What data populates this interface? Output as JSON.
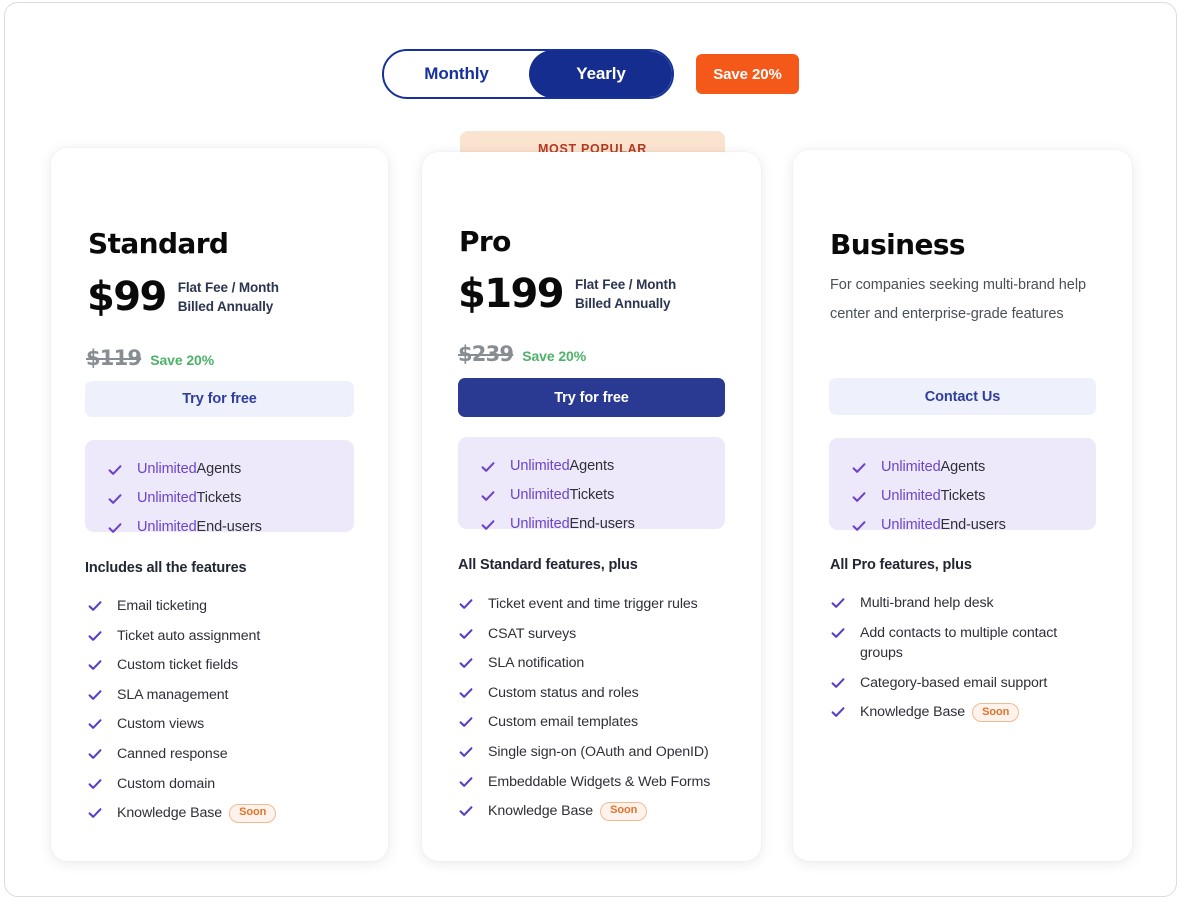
{
  "billing_toggle": {
    "monthly_label": "Monthly",
    "yearly_label": "Yearly",
    "selected": "Yearly",
    "save_badge_label": "Save 20%",
    "accent_color": "#17329b",
    "save_badge_color": "#f4591a"
  },
  "most_popular_label": "MOST POPULAR",
  "soon_label": "Soon",
  "plans": [
    {
      "name": "Standard",
      "price": "$99",
      "price_note_line1": "Flat Fee / Month",
      "price_note_line2": "Billed Annually",
      "old_price": "$119",
      "save_label": "Save 20%",
      "cta_label": "Try for free",
      "cta_style": "light",
      "unlimited": [
        {
          "highlight": "Unlimited",
          "rest": " Agents"
        },
        {
          "highlight": "Unlimited",
          "rest": " Tickets"
        },
        {
          "highlight": "Unlimited",
          "rest": " End-users"
        }
      ],
      "features_title": "Includes all the features",
      "features": [
        {
          "text": "Email ticketing",
          "badge": ""
        },
        {
          "text": "Ticket auto assignment",
          "badge": ""
        },
        {
          "text": "Custom ticket fields",
          "badge": ""
        },
        {
          "text": "SLA management",
          "badge": ""
        },
        {
          "text": "Custom views",
          "badge": ""
        },
        {
          "text": "Canned response",
          "badge": ""
        },
        {
          "text": "Custom domain",
          "badge": ""
        },
        {
          "text": "Knowledge Base",
          "badge": "Soon"
        }
      ]
    },
    {
      "name": "Pro",
      "price": "$199",
      "price_note_line1": "Flat Fee / Month",
      "price_note_line2": "Billed Annually",
      "old_price": "$239",
      "save_label": "Save 20%",
      "cta_label": "Try for free",
      "cta_style": "solid",
      "unlimited": [
        {
          "highlight": "Unlimited",
          "rest": " Agents"
        },
        {
          "highlight": "Unlimited",
          "rest": " Tickets"
        },
        {
          "highlight": "Unlimited",
          "rest": " End-users"
        }
      ],
      "features_title": "All Standard features, plus",
      "features": [
        {
          "text": "Ticket event and time trigger rules",
          "badge": ""
        },
        {
          "text": "CSAT surveys",
          "badge": ""
        },
        {
          "text": "SLA notification",
          "badge": ""
        },
        {
          "text": "Custom status and roles",
          "badge": ""
        },
        {
          "text": "Custom email templates",
          "badge": ""
        },
        {
          "text": "Single sign-on (OAuth and OpenID)",
          "badge": ""
        },
        {
          "text": "Embeddable Widgets & Web Forms",
          "badge": ""
        },
        {
          "text": "Knowledge Base",
          "badge": "Soon"
        }
      ]
    },
    {
      "name": "Business",
      "description": "For companies seeking multi-brand help center and enterprise-grade features",
      "cta_label": "Contact Us",
      "cta_style": "light",
      "unlimited": [
        {
          "highlight": "Unlimited",
          "rest": " Agents"
        },
        {
          "highlight": "Unlimited",
          "rest": " Tickets"
        },
        {
          "highlight": "Unlimited",
          "rest": " End-users"
        }
      ],
      "features_title": "All Pro features, plus",
      "features": [
        {
          "text": "Multi-brand help desk",
          "badge": ""
        },
        {
          "text": "Add contacts to multiple contact groups",
          "badge": ""
        },
        {
          "text": "Category-based email support",
          "badge": ""
        },
        {
          "text": "Knowledge Base",
          "badge": "Soon"
        }
      ]
    }
  ]
}
